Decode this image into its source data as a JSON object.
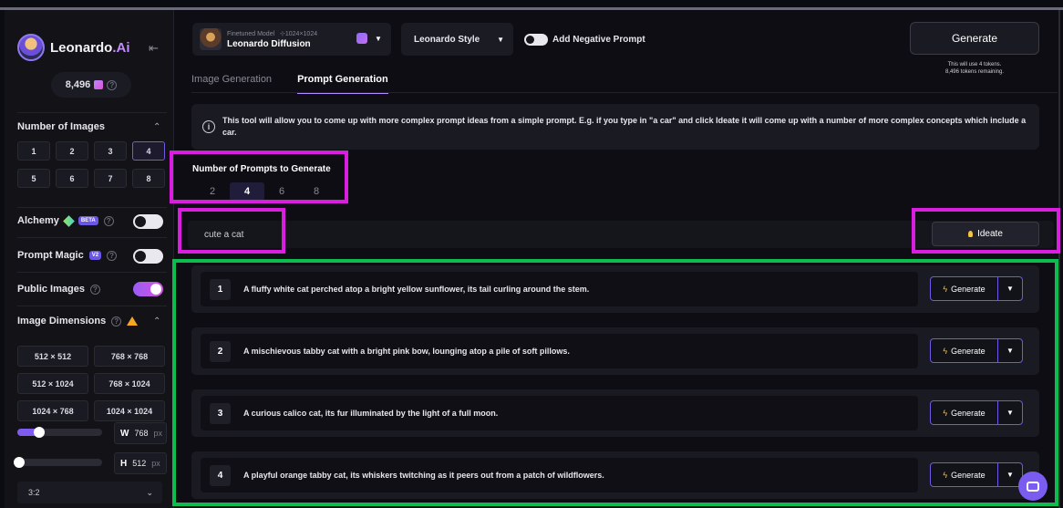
{
  "brand": {
    "name": "Leonardo",
    "suffix": ".Ai"
  },
  "sidebar": {
    "tokens": "8,496",
    "num_images_label": "Number of Images",
    "num_images": [
      "1",
      "2",
      "3",
      "4",
      "5",
      "6",
      "7",
      "8"
    ],
    "num_images_selected": "4",
    "alchemy_label": "Alchemy",
    "alchemy_badge": "BETA",
    "alchemy_on": false,
    "prompt_magic_label": "Prompt Magic",
    "prompt_magic_badge": "V2",
    "prompt_magic_on": false,
    "public_images_label": "Public Images",
    "public_images_on": true,
    "dimensions_label": "Image Dimensions",
    "dimensions": [
      "512 × 512",
      "768 × 768",
      "512 × 1024",
      "768 × 1024",
      "1024 × 768",
      "1024 × 1024"
    ],
    "width_label": "W",
    "width_value": "768",
    "height_label": "H",
    "height_value": "512",
    "unit": "px",
    "aspect_ratio": "3:2"
  },
  "header": {
    "model_subtitle": "Finetuned Model",
    "model_size": "1024×1024",
    "model_name": "Leonardo Diffusion",
    "style": "Leonardo Style",
    "negative_prompt_label": "Add Negative Prompt",
    "negative_prompt_on": false,
    "generate_label": "Generate",
    "token_note_1": "This will use 4 tokens.",
    "token_note_2": "8,496 tokens remaining."
  },
  "tabs": [
    {
      "label": "Image Generation",
      "active": false
    },
    {
      "label": "Prompt Generation",
      "active": true
    }
  ],
  "info": "This tool will allow you to come up with more complex prompt ideas from a simple prompt. E.g. if you type in \"a car\" and click Ideate it will come up with a number of more complex concepts which include a car.",
  "prompt_count": {
    "label": "Number of Prompts to Generate",
    "options": [
      "2",
      "4",
      "6",
      "8"
    ],
    "selected": "4"
  },
  "prompt_input": {
    "value": "cute a cat"
  },
  "ideate_label": "Ideate",
  "results": [
    {
      "num": "1",
      "text": "A fluffy white cat perched atop a bright yellow sunflower, its tail curling around the stem."
    },
    {
      "num": "2",
      "text": "A mischievous tabby cat with a bright pink bow, lounging atop a pile of soft pillows."
    },
    {
      "num": "3",
      "text": "A curious calico cat, its fur illuminated by the light of a full moon."
    },
    {
      "num": "4",
      "text": "A playful orange tabby cat, its whiskers twitching as it peers out from a patch of wildflowers."
    }
  ],
  "row_generate_label": "Generate",
  "colors": {
    "accent": "#7e5cf0",
    "highlight_magenta": "#d91ee0",
    "highlight_green": "#0dbb4f"
  }
}
